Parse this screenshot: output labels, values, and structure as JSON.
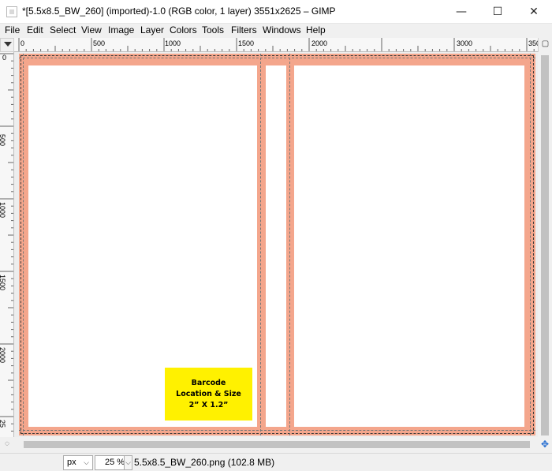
{
  "window": {
    "title": "*[5.5x8.5_BW_260] (imported)-1.0 (RGB color, 1 layer) 3551x2625 – GIMP",
    "minimize_glyph": "—",
    "maximize_glyph": "☐",
    "close_glyph": "✕"
  },
  "menu": {
    "items": [
      "File",
      "Edit",
      "Select",
      "View",
      "Image",
      "Layer",
      "Colors",
      "Tools",
      "Filters",
      "Windows",
      "Help"
    ]
  },
  "ruler": {
    "horizontal_labels": [
      "0",
      "500",
      "1000",
      "1500",
      "2000",
      "3000",
      "350"
    ],
    "vertical_labels": [
      "0",
      "500",
      "1000",
      "1500",
      "2000",
      "25"
    ]
  },
  "canvas": {
    "bleed_color": "#f4a68c",
    "panel_color": "#ffffff",
    "barcode": {
      "line1": "Barcode",
      "line2": "Location & Size",
      "line3": "2” X 1.2”",
      "color": "#fff100"
    }
  },
  "status": {
    "unit": "px",
    "zoom": "25 %",
    "file_info": "5.5x8.5_BW_260.png (102.8 MB)"
  }
}
